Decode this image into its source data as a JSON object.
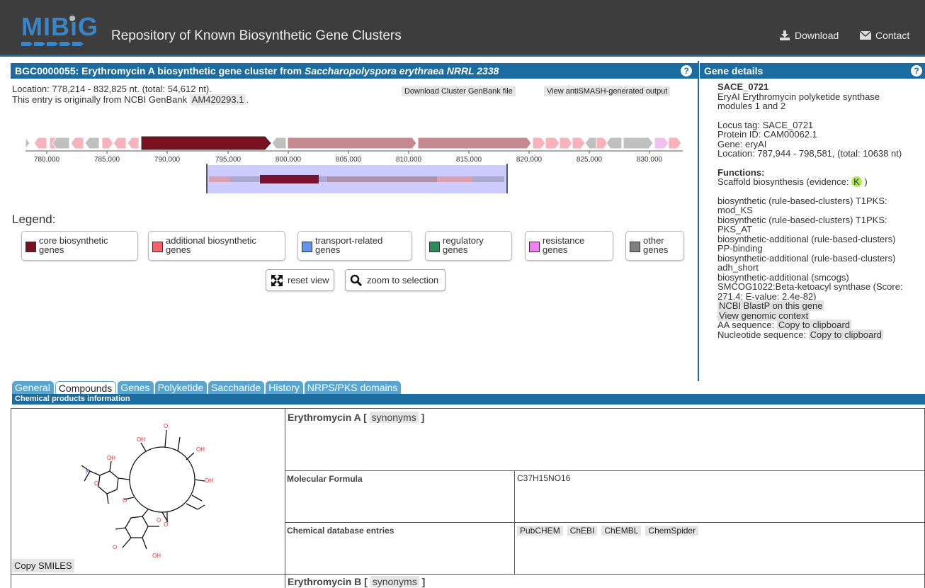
{
  "header": {
    "logo_text": "MIBiG",
    "site_title": "Repository of Known Biosynthetic Gene Clusters",
    "download_label": "Download",
    "contact_label": "Contact"
  },
  "cluster": {
    "title_prefix": "BGC0000055: Erythromycin A biosynthetic gene cluster from ",
    "title_organism": "Saccharopolyspora erythraea NRRL 2338",
    "location_text": "Location: 778,214 - 832,825 nt. (total: 54,612 nt).",
    "origin_text": "This entry is originally from NCBI GenBank",
    "accession": "AM420293.1",
    "accession_suffix": ".",
    "download_genbank_label": "Download Cluster GenBank file",
    "antismash_label": "View antiSMASH-generated output",
    "help_icon": "?",
    "axis_ticks": [
      "780,000",
      "785,000",
      "790,000",
      "795,000",
      "800,000",
      "805,000",
      "810,000",
      "815,000",
      "820,000",
      "825,000",
      "830,000"
    ]
  },
  "legend": {
    "title": "Legend:",
    "items": [
      {
        "line1": "core biosynthetic",
        "line2": "genes",
        "color": "#7a1020"
      },
      {
        "line1": "additional biosynthetic",
        "line2": "genes",
        "color": "#f0646e"
      },
      {
        "line1": "transport-related",
        "line2": "genes",
        "color": "#6495ed"
      },
      {
        "line1": "regulatory",
        "line2": "genes",
        "color": "#2e8b57"
      },
      {
        "line1": "resistance",
        "line2": "genes",
        "color": "#ee82ee"
      },
      {
        "line1": "other",
        "line2": "genes",
        "color": "#808080"
      }
    ],
    "reset_label": "reset view",
    "zoom_label": "zoom to selection"
  },
  "gene_details": {
    "heading": "Gene details",
    "help_icon": "?",
    "gene_name": "SACE_0721",
    "product_line1": "EryAI Erythromycin polyketide synthase",
    "product_line2": "modules 1 and 2",
    "locus_tag": "Locus tag: SACE_0721",
    "protein_id": "Protein ID: CAM00062.1",
    "gene": "Gene: eryAI",
    "location": "Location: 787,944 - 798,581, (total: 10638 nt)",
    "functions_heading": "Functions:",
    "function_text": "Scaffold biosynthesis (evidence:",
    "evidence_code": "K",
    "function_close": ")",
    "annotations": [
      "biosynthetic (rule-based-clusters) T1PKS:",
      "mod_KS",
      "biosynthetic (rule-based-clusters) T1PKS:",
      "PKS_AT",
      "biosynthetic-additional (rule-based-clusters)",
      "PP-binding",
      "biosynthetic-additional (rule-based-clusters)",
      "adh_short",
      "biosynthetic-additional (smcogs)",
      "SMCOG1022:Beta-ketoacyl synthase (Score:",
      "271.4; E-value: 2.4e-82)"
    ],
    "blastp_label": "NCBI BlastP on this gene",
    "genomic_context_label": "View genomic context",
    "aa_label": "AA sequence:",
    "nt_label": "Nucleotide sequence:",
    "copy_label": "Copy to clipboard"
  },
  "tabs": [
    "General",
    "Compounds",
    "Genes",
    "Polyketide",
    "Saccharide",
    "History",
    "NRPS/PKS domains"
  ],
  "active_tab": "Compounds",
  "section_title": "Chemical products information",
  "compounds": [
    {
      "name": "Erythromycin A",
      "synonyms_label": "synonyms",
      "formula_label": "Molecular Formula",
      "formula": "C37H15NO16",
      "db_label": "Chemical database entries",
      "db_links": [
        "PubCHEM",
        "ChEBI",
        "ChEMBL",
        "ChemSpider"
      ],
      "copy_smiles": "Copy SMILES"
    },
    {
      "name": "Erythromycin B",
      "synonyms_label": "synonyms"
    }
  ],
  "colors": {
    "header_bg": "#3d3d3d",
    "accent_blue": "#1b6ca0",
    "tab_blue": "#5aa5cf",
    "core_gene": "#7a1020",
    "pks_gene": "#c48a90",
    "additional_gene": "#f7b3bb",
    "other_gene": "#c0c0c0"
  }
}
